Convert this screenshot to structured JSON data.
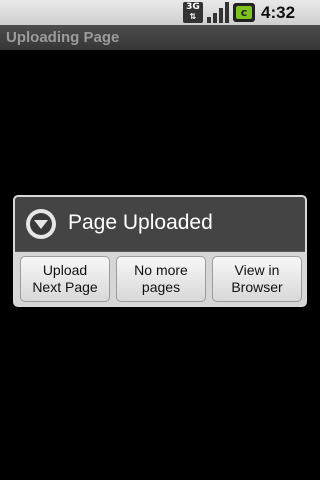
{
  "status_bar": {
    "network_label": "3G",
    "network_arrows": "⇅",
    "battery_glyph": "c",
    "time": "4:32 pm",
    "icons": [
      "3g-data-icon",
      "signal-strength-icon",
      "battery-icon"
    ]
  },
  "title_bar": {
    "title": "Uploading Page"
  },
  "dialog": {
    "title": "Page Uploaded",
    "icon": "dropdown-arrow-icon",
    "buttons": [
      {
        "label": "Upload\nNext Page"
      },
      {
        "label": "No more\npages"
      },
      {
        "label": "View in\nBrowser"
      }
    ]
  },
  "colors": {
    "background": "#000000",
    "dialog_header": "#444444",
    "battery_accent": "#7ec21d"
  }
}
